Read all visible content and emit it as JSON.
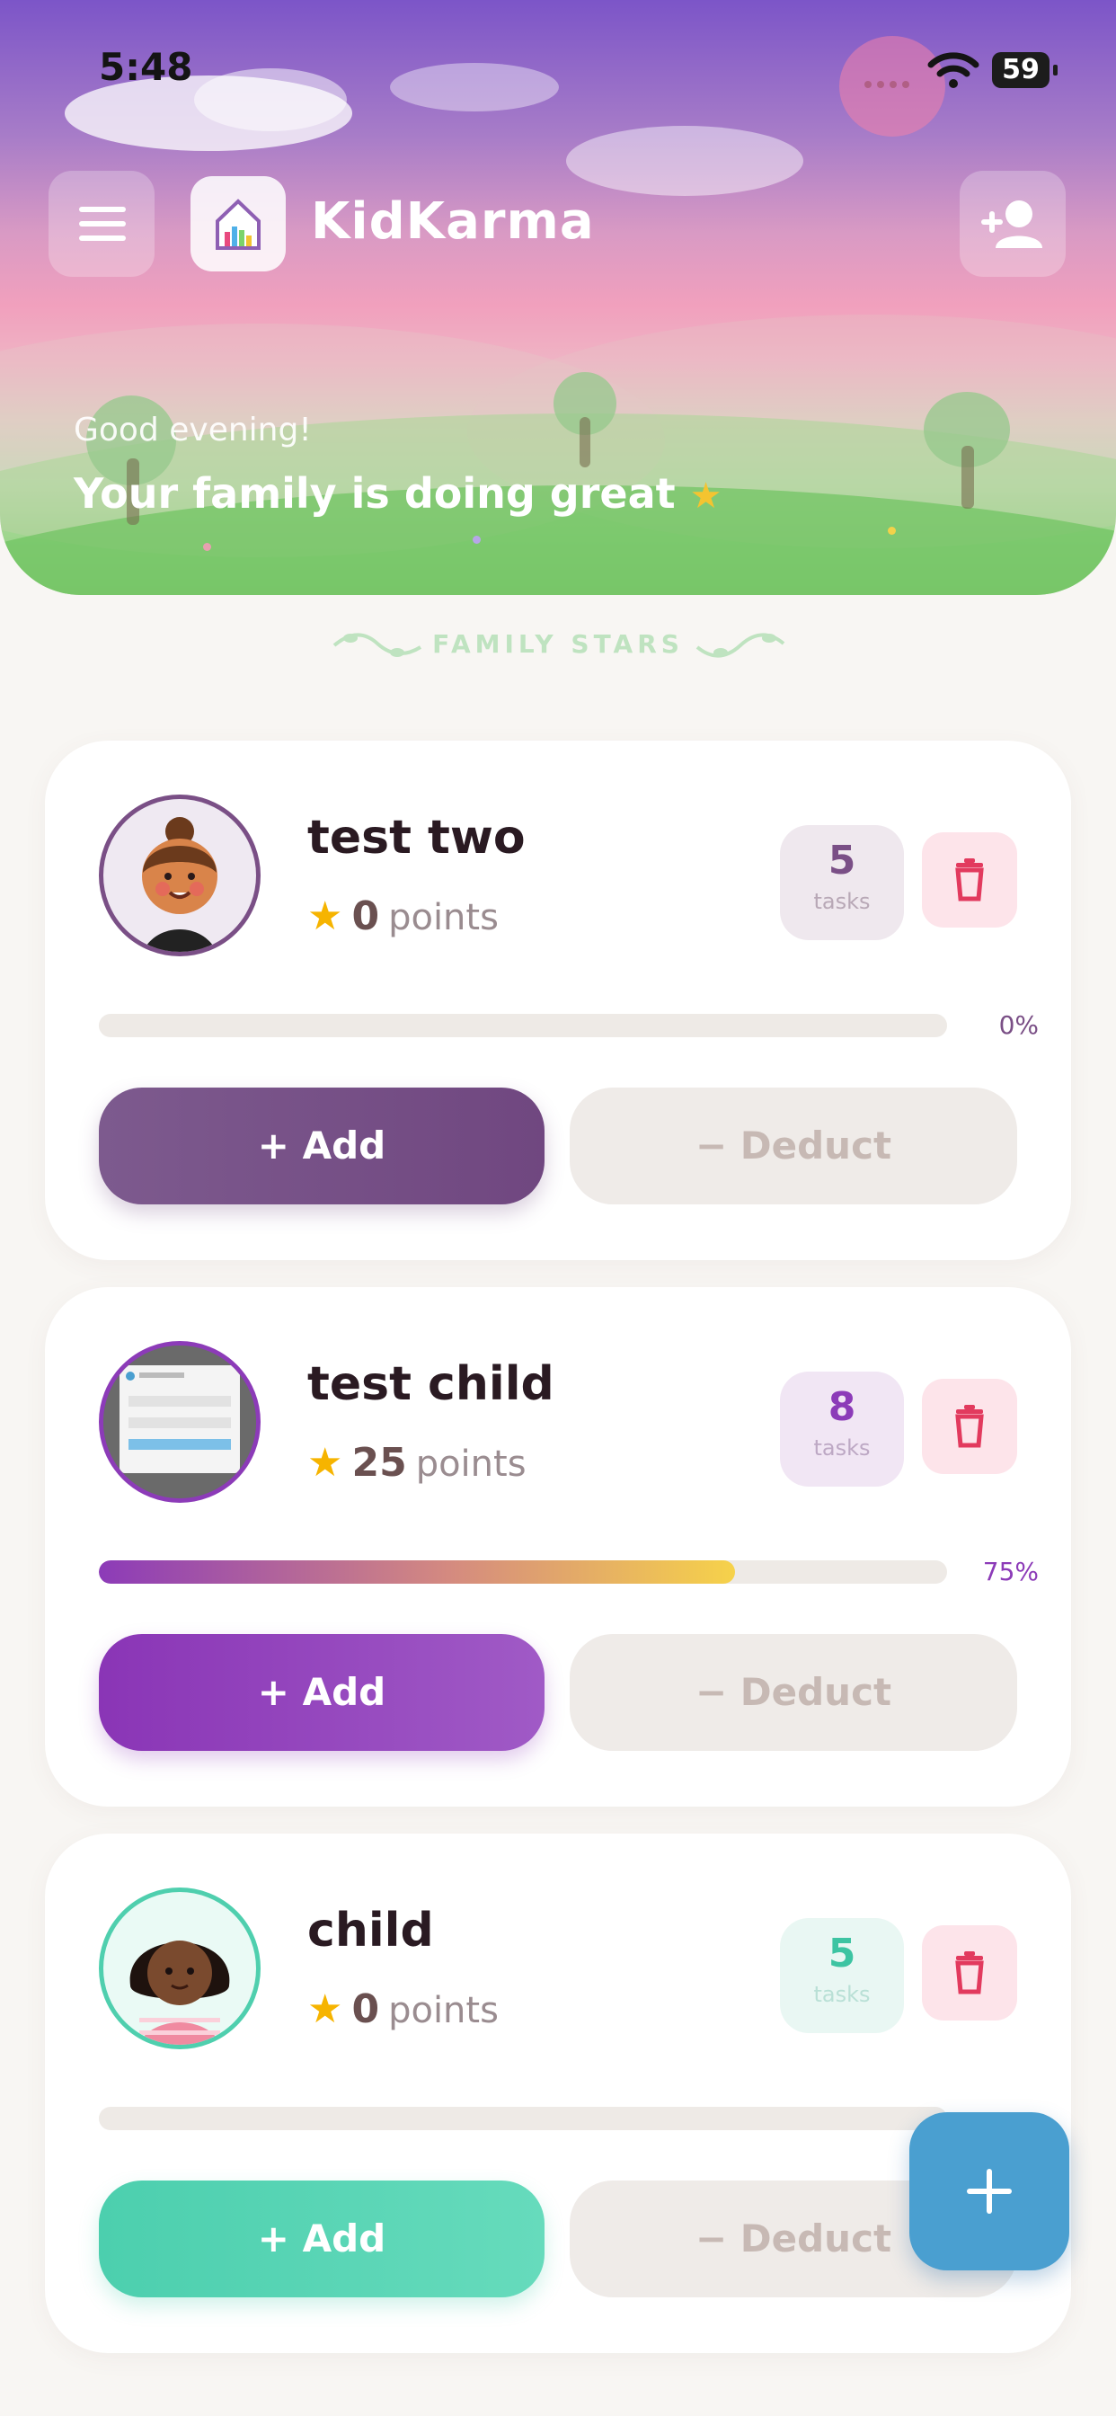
{
  "status_bar": {
    "time": "5:48",
    "battery": "59"
  },
  "header": {
    "app_title": "KidKarma",
    "greeting": "Good evening!",
    "headline": "Your family is doing great"
  },
  "section_title": "FAMILY STARS",
  "children": [
    {
      "name": "test two",
      "points": "0",
      "points_label": "points",
      "tasks": "5",
      "tasks_label": "tasks",
      "progress_text": "0%",
      "progress": 0.0,
      "add_label": "+ Add",
      "deduct_label": "− Deduct",
      "theme_color": "#7a4f86"
    },
    {
      "name": "test child",
      "points": "25",
      "points_label": "points",
      "tasks": "8",
      "tasks_label": "tasks",
      "progress_text": "75%",
      "progress": 0.75,
      "add_label": "+ Add",
      "deduct_label": "− Deduct",
      "theme_color": "#8c3bb8"
    },
    {
      "name": "child",
      "points": "0",
      "points_label": "points",
      "tasks": "5",
      "tasks_label": "tasks",
      "add_label": "+ Add",
      "deduct_label": "− Deduct",
      "theme_color": "#4fcfae"
    }
  ],
  "icons": {
    "menu": "hamburger-menu-icon",
    "logo": "house-logo-icon",
    "add_user": "add-user-icon",
    "delete": "trash-icon",
    "star": "star-icon",
    "fab": "plus-icon"
  }
}
